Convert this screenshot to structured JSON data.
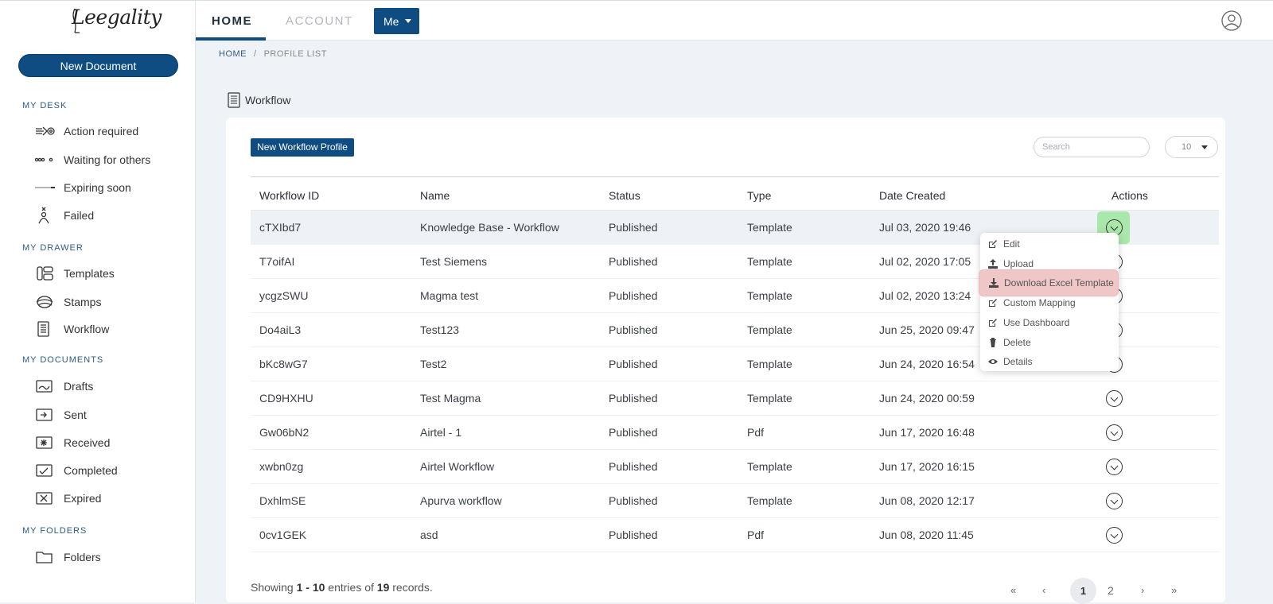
{
  "app": {
    "logo_text": "Leegality"
  },
  "sidebar": {
    "new_document": "New Document",
    "sections": [
      {
        "title": "MY DESK",
        "items": [
          {
            "label": "Action required",
            "icon": "arrow-target-icon"
          },
          {
            "label": "Waiting for others",
            "icon": "dots-icon"
          },
          {
            "label": "Expiring soon",
            "icon": "line-icon"
          },
          {
            "label": "Failed",
            "icon": "person-x-icon"
          }
        ]
      },
      {
        "title": "MY DRAWER",
        "items": [
          {
            "label": "Templates",
            "icon": "templates-icon"
          },
          {
            "label": "Stamps",
            "icon": "stamp-icon"
          },
          {
            "label": "Workflow",
            "icon": "workflow-icon"
          }
        ]
      },
      {
        "title": "MY DOCUMENTS",
        "items": [
          {
            "label": "Drafts",
            "icon": "drafts-icon"
          },
          {
            "label": "Sent",
            "icon": "sent-icon"
          },
          {
            "label": "Received",
            "icon": "received-icon"
          },
          {
            "label": "Completed",
            "icon": "completed-icon"
          },
          {
            "label": "Expired",
            "icon": "expired-icon"
          }
        ]
      },
      {
        "title": "MY FOLDERS",
        "items": [
          {
            "label": "Folders",
            "icon": "folder-icon"
          }
        ]
      }
    ]
  },
  "topbar": {
    "tabs": [
      "HOME",
      "ACCOUNT"
    ],
    "active_tab": "HOME",
    "me_label": "Me"
  },
  "breadcrumb": {
    "home": "HOME",
    "current": "PROFILE LIST"
  },
  "page": {
    "title": "Workflow",
    "new_button": "New Workflow Profile",
    "search_placeholder": "Search",
    "page_size": "10"
  },
  "table": {
    "columns": [
      "Workflow ID",
      "Name",
      "Status",
      "Type",
      "Date Created",
      "Actions"
    ],
    "rows": [
      [
        "cTXIbd7",
        "Knowledge Base - Workflow",
        "Published",
        "Template",
        "Jul 03, 2020 19:46"
      ],
      [
        "T7oifAI",
        "Test Siemens",
        "Published",
        "Template",
        "Jul 02, 2020 17:05"
      ],
      [
        "ycgzSWU",
        "Magma test",
        "Published",
        "Template",
        "Jul 02, 2020 13:24"
      ],
      [
        "Do4aiL3",
        "Test123",
        "Published",
        "Template",
        "Jun 25, 2020 09:47"
      ],
      [
        "bKc8wG7",
        "Test2",
        "Published",
        "Template",
        "Jun 24, 2020 16:54"
      ],
      [
        "CD9HXHU",
        "Test Magma",
        "Published",
        "Template",
        "Jun 24, 2020 00:59"
      ],
      [
        "Gw06bN2",
        "Airtel - 1",
        "Published",
        "Pdf",
        "Jun 17, 2020 16:48"
      ],
      [
        "xwbn0zg",
        "Airtel Workflow",
        "Published",
        "Template",
        "Jun 17, 2020 16:15"
      ],
      [
        "DxhlmSE",
        "Apurva workflow",
        "Published",
        "Template",
        "Jun 08, 2020 12:17"
      ],
      [
        "0cv1GEK",
        "asd",
        "Published",
        "Pdf",
        "Jun 08, 2020 11:45"
      ]
    ]
  },
  "dropdown": {
    "items": [
      "Edit",
      "Upload",
      "Download Excel Template",
      "Custom Mapping",
      "Use Dashboard",
      "Delete",
      "Details"
    ],
    "highlighted": "Download Excel Template"
  },
  "footer": {
    "prefix": "Showing ",
    "range": "1 - 10",
    "middle": " entries of ",
    "total": "19",
    "suffix": " records."
  },
  "pagination": {
    "first": "«",
    "prev": "‹",
    "pages": [
      "1",
      "2"
    ],
    "current": "1",
    "next": "›",
    "last": "»"
  }
}
